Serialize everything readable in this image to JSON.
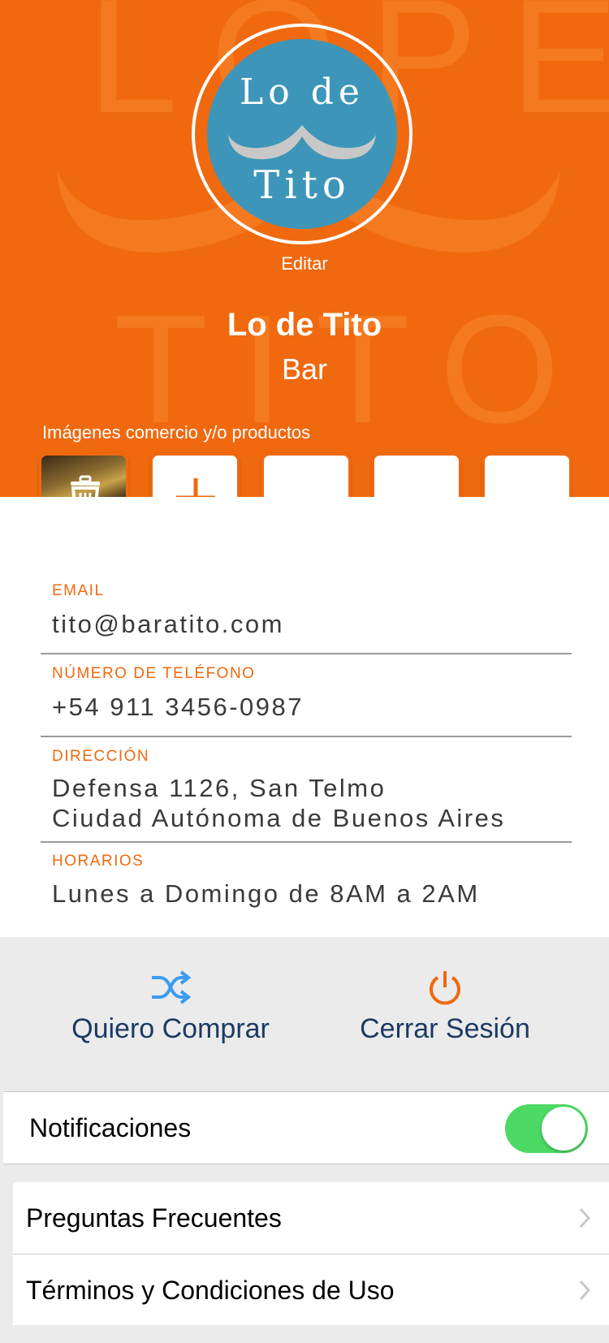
{
  "header": {
    "logo": {
      "text_top": "Lo de",
      "text_bottom": "Tito",
      "colors": {
        "disc": "#3d96b9",
        "ring": "#ffffff",
        "mustache": "#c8c8c8"
      }
    },
    "edit_label": "Editar",
    "business_name": "Lo de Tito",
    "business_type": "Bar",
    "images_label": "Imágenes comercio y/o productos",
    "background_color": "#f0690f",
    "thumbnails": [
      {
        "kind": "photo",
        "icon": "trash-icon"
      },
      {
        "kind": "add",
        "icon": "plus-icon"
      },
      {
        "kind": "empty"
      },
      {
        "kind": "empty"
      },
      {
        "kind": "empty"
      }
    ]
  },
  "fields": {
    "email": {
      "label": "EMAIL",
      "value": "tito@baratito.com"
    },
    "phone": {
      "label": "NÚMERO DE TELÉFONO",
      "value": "+54 911 3456-0987"
    },
    "address": {
      "label": "DIRECCIÓN",
      "line1": "Defensa 1126, San Telmo",
      "line2": "Ciudad Autónoma de Buenos Aires"
    },
    "hours": {
      "label": "HORARIOS",
      "value": "Lunes a Domingo de 8AM a 2AM"
    }
  },
  "actions": {
    "buy": {
      "label": "Quiero Comprar",
      "icon": "shuffle-icon",
      "icon_color": "#3a9bf0"
    },
    "logout": {
      "label": "Cerrar Sesión",
      "icon": "power-icon",
      "icon_color": "#f0690f"
    }
  },
  "settings": {
    "notifications": {
      "label": "Notificaciones",
      "enabled": true,
      "toggle_color": "#4cd964"
    },
    "menu": [
      {
        "label": "Preguntas Frecuentes",
        "icon": "chevron-right-icon"
      },
      {
        "label": "Términos y Condiciones de Uso",
        "icon": "chevron-right-icon"
      }
    ]
  }
}
